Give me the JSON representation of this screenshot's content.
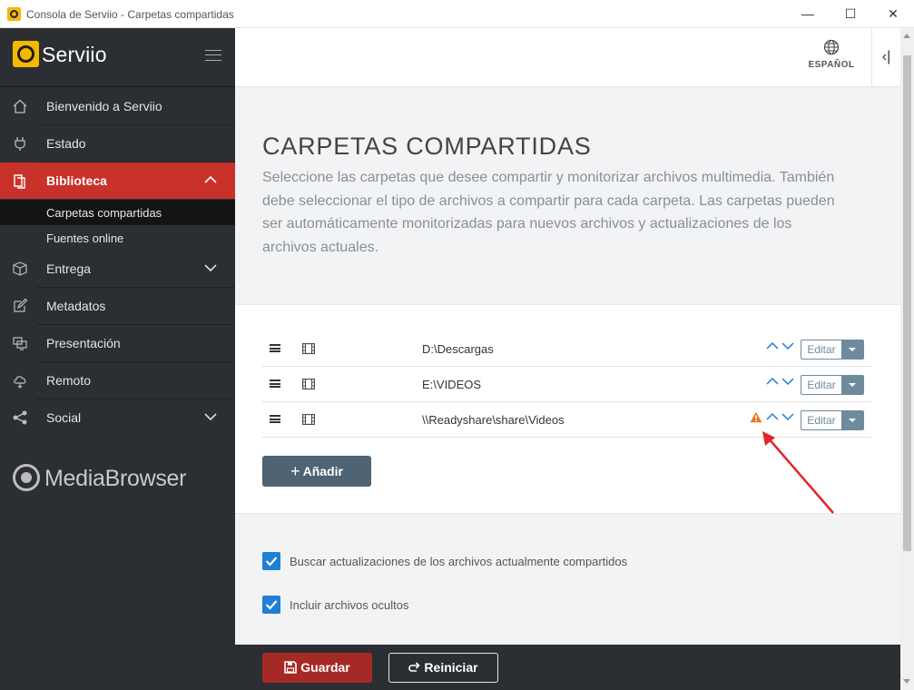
{
  "window": {
    "title": "Consola de Serviio - Carpetas compartidas",
    "min": "—",
    "max": "☐",
    "close": "✕"
  },
  "sidebar": {
    "brand": "Serviio",
    "items": [
      {
        "label": "Bienvenido a Serviio",
        "icon": "home-icon"
      },
      {
        "label": "Estado",
        "icon": "plug-icon"
      },
      {
        "label": "Biblioteca",
        "icon": "library-icon",
        "active": true
      },
      {
        "label": "Entrega",
        "icon": "package-icon"
      },
      {
        "label": "Metadatos",
        "icon": "edit-icon"
      },
      {
        "label": "Presentación",
        "icon": "screens-icon"
      },
      {
        "label": "Remoto",
        "icon": "cloud-icon"
      },
      {
        "label": "Social",
        "icon": "share-icon"
      }
    ],
    "sub_items": [
      {
        "label": "Carpetas compartidas",
        "active": true
      },
      {
        "label": "Fuentes online"
      }
    ],
    "media_browser": "MediaBrowser"
  },
  "header": {
    "language": "ESPAÑOL",
    "collapse": "‹|"
  },
  "main": {
    "title": "CARPETAS COMPARTIDAS",
    "description": "Seleccione las carpetas que desee compartir y monitorizar archivos multimedia. También debe seleccionar el tipo de archivos a compartir para cada carpeta. Las carpetas pueden ser automáticamente monitorizadas para nuevos archivos y actualizaciones de los archivos actuales.",
    "folders": [
      {
        "path": "D:\\Descargas",
        "warning": false,
        "edit": "Editar"
      },
      {
        "path": "E:\\VIDEOS",
        "warning": false,
        "edit": "Editar"
      },
      {
        "path": "\\\\Readyshare\\share\\Videos",
        "warning": true,
        "edit": "Editar"
      }
    ],
    "add_button": "Añadir",
    "options": [
      {
        "label": "Buscar actualizaciones de los archivos actualmente compartidos",
        "checked": true
      },
      {
        "label": "Incluir archivos ocultos",
        "checked": true
      }
    ]
  },
  "footer": {
    "save": "Guardar",
    "reset": "Reiniciar"
  },
  "colors": {
    "accent_red": "#c8322a",
    "sidebar_bg": "#2b2f33",
    "edit_blue": "#6f8a9d",
    "checkbox_blue": "#1f7fd4",
    "warning_orange": "#e8761a",
    "annotation_red": "#e0262a"
  }
}
